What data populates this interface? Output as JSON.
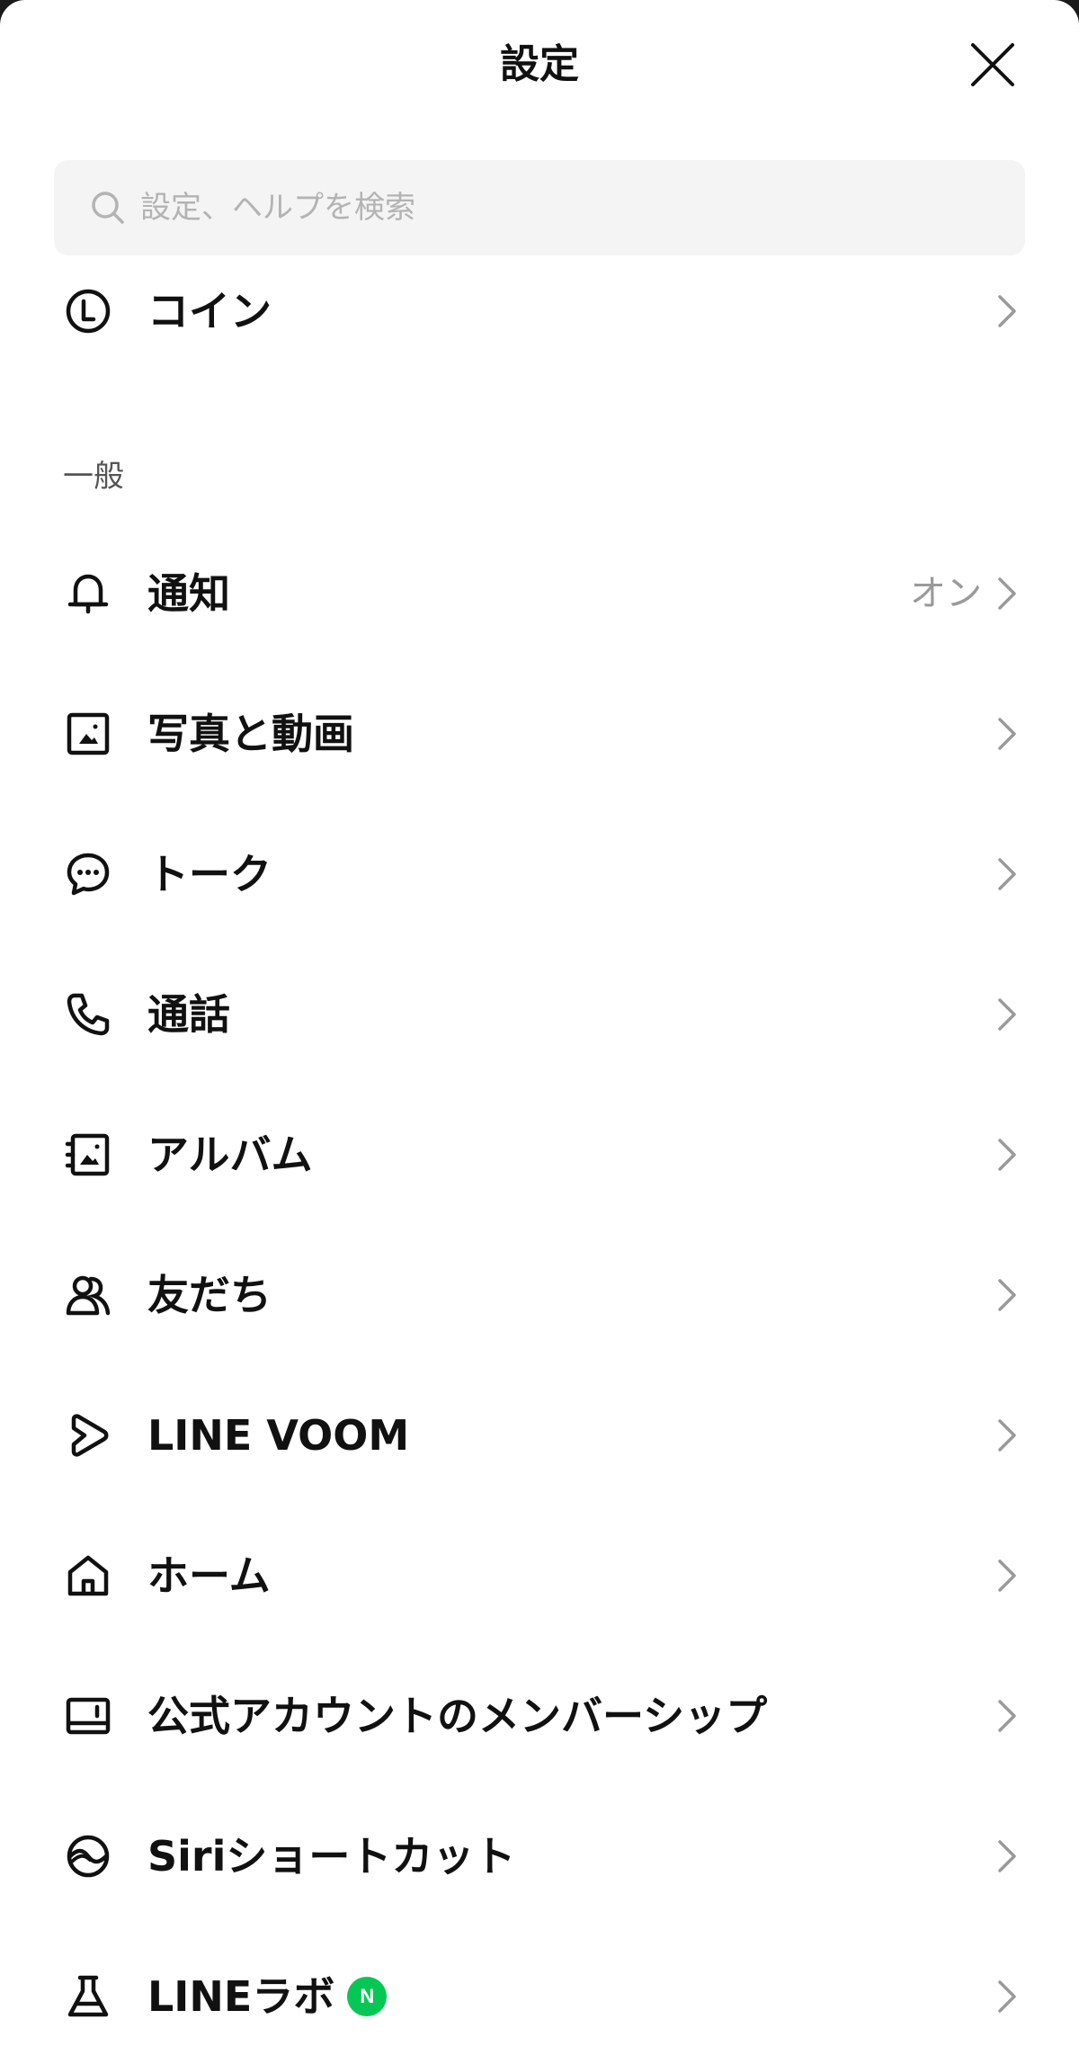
{
  "header": {
    "title": "設定"
  },
  "search": {
    "placeholder": "設定、ヘルプを検索"
  },
  "top_item": {
    "label": "コイン"
  },
  "section_general": {
    "label": "一般"
  },
  "items": [
    {
      "label": "通知",
      "value": "オン"
    },
    {
      "label": "写真と動画"
    },
    {
      "label": "トーク"
    },
    {
      "label": "通話"
    },
    {
      "label": "アルバム"
    },
    {
      "label": "友だち"
    },
    {
      "label": "LINE VOOM"
    },
    {
      "label": "ホーム"
    },
    {
      "label": "公式アカウントのメンバーシップ"
    },
    {
      "label": "Siriショートカット"
    },
    {
      "label": "LINEラボ",
      "badge": "N"
    }
  ],
  "colors": {
    "badge_green": "#06c755",
    "search_bg": "#f4f4f4",
    "chevron": "#9a9a9a"
  }
}
